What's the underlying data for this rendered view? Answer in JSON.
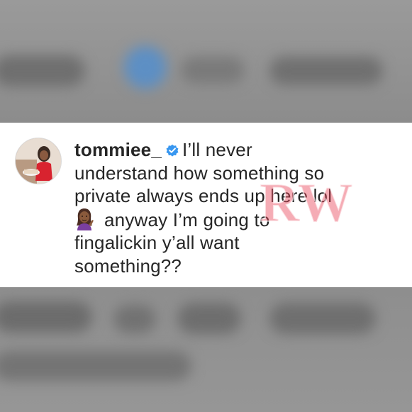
{
  "comment": {
    "username": "tommiee_",
    "text_line_1": "I’ll never",
    "text_line_2": "understand how something so",
    "text_line_3": "private always ends up here lol",
    "text_line_4": "anyway I’m going to",
    "text_line_5": "fingalickin y’all want",
    "text_line_6": "something??"
  },
  "watermark": {
    "text": "RW"
  },
  "colors": {
    "verified_badge": "#3897f0",
    "watermark": "#e9475b",
    "text": "#262626"
  },
  "icons": [
    "verified-badge-icon",
    "woman-gesturing-emoji-icon",
    "avatar"
  ]
}
